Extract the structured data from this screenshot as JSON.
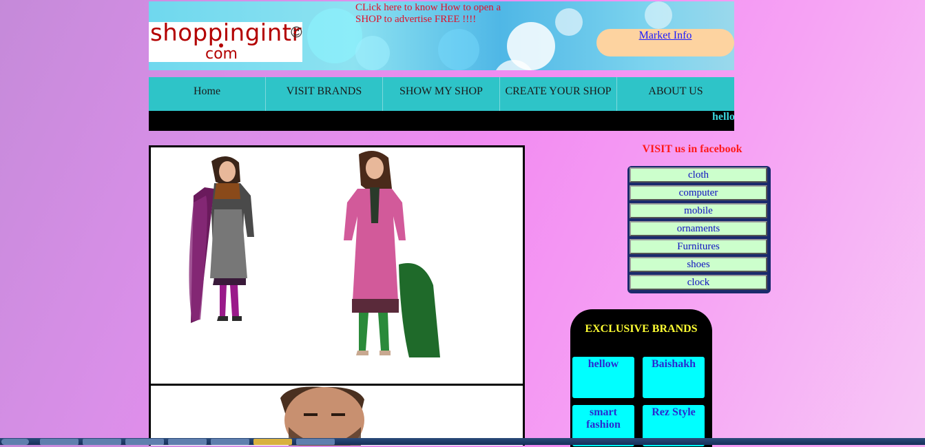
{
  "header": {
    "logo_line1": "shoppingintr",
    "logo_smile": "☺",
    "logo_line2": "com",
    "promo_text": "CLick here to know How to open a SHOP to advertise FREE !!!!",
    "market_info_link": "Market Info"
  },
  "nav": {
    "items": [
      "Home",
      "VISIT BRANDS",
      "SHOW MY SHOP",
      "CREATE YOUR SHOP",
      "ABOUT US"
    ]
  },
  "marquee": {
    "text": "hello"
  },
  "sidebar": {
    "facebook_text": "VISIT us in facebook",
    "categories": [
      "cloth",
      "computer",
      "mobile",
      "ornaments",
      "Furnitures",
      "shoes",
      "clock"
    ]
  },
  "exclusive": {
    "title": "EXCLUSIVE BRANDS",
    "brands": [
      "hellow",
      "Baishakh",
      "smart fashion",
      "Rez Style"
    ]
  },
  "colors": {
    "nav_bg": "#2ec4c8",
    "promo_red": "#e0102a",
    "category_bg": "#ccffcc",
    "brand_bg": "#00ffff",
    "exclusive_title": "#ffff33"
  }
}
